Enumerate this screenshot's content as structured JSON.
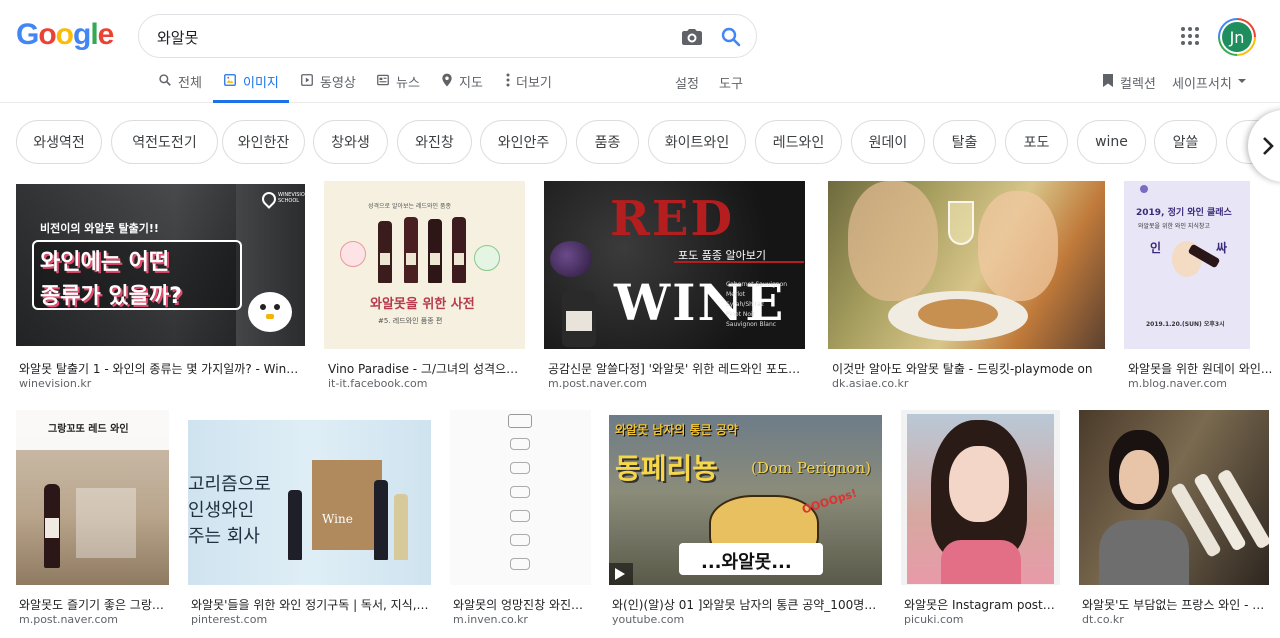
{
  "logo": "Google",
  "search": {
    "value": "와알못"
  },
  "header": {
    "avatar_initials": "Jn"
  },
  "tabs": [
    {
      "label": "전체"
    },
    {
      "label": "이미지"
    },
    {
      "label": "동영상"
    },
    {
      "label": "뉴스"
    },
    {
      "label": "지도"
    },
    {
      "label": "더보기"
    }
  ],
  "tools": {
    "settings": "설정",
    "tools": "도구",
    "collections": "컬렉션",
    "safesearch": "세이프서치"
  },
  "chips": [
    "와생역전",
    "역전도전기",
    "와인한잔",
    "창와생",
    "와진창",
    "와인안주",
    "품종",
    "화이트와인",
    "레드와인",
    "원데이",
    "탈출",
    "포도",
    "wine",
    "알쓸"
  ],
  "results": [
    {
      "title": "와알못 탈출기 1 - 와인의 종류는 몇 가지일까? - Winevisio...",
      "source": "winevision.kr",
      "overlay": [
        "비전이의 와알못 탈출기!!",
        "와인에는 어떤",
        "종류가 있을까?",
        "WINEVISION SCHOOL"
      ]
    },
    {
      "title": "Vino Paradise - 그/그녀의 성격으로 ...",
      "source": "it-it.facebook.com",
      "overlay": [
        "성격으로 알아보는 레드와인 품종",
        "와알못을 위한 사전",
        "#5. 레드와인 품종 편"
      ]
    },
    {
      "title": "공감신문 알쓸다정] '와알못' 위한 레드와인 포도 품종 ...",
      "source": "m.post.naver.com",
      "overlay": [
        "RED",
        "WINE",
        "포도 품종 알아보기",
        "Cabernet Sauvignon",
        "Merlot",
        "Syrah/Shiraz",
        "Pinot Noir",
        "Sauvignon Blanc"
      ]
    },
    {
      "title": "이것만 알아도 와알못 탈출 - 드링킷-playmode on",
      "source": "dk.asiae.co.kr",
      "overlay": []
    },
    {
      "title": "와알못을 위한 원데이 와인...",
      "source": "m.blog.naver.com",
      "overlay": [
        "2019, 정기 와인 클래스",
        "와알못을 위한 와인 지식창고",
        "인",
        "싸",
        "2019.1.20.(SUN) 오후3시"
      ]
    },
    {
      "title": "와알못도 즐기기 좋은 그랑꼬...",
      "source": "m.post.naver.com",
      "overlay": [
        "그랑꼬또 레드 와인"
      ]
    },
    {
      "title": "와알못'들을 위한 와인 정기구독 | 독서, 지식, 긍정...",
      "source": "pinterest.com",
      "overlay": [
        "고리즘으로",
        "인생와인",
        "주는 회사",
        "Wine"
      ]
    },
    {
      "title": "와알못의 엉망진창 와진창 ...",
      "source": "m.inven.co.kr",
      "overlay": []
    },
    {
      "title": "와(인)(알)상 01 ]와알못 남자의 통큰 공약_100명 구독...",
      "source": "youtube.com",
      "overlay": [
        "와알못 남자의 통큰 공약",
        "동페리뇽",
        "(Dom Perignon)",
        "OOOOps!",
        "...와알못..."
      ]
    },
    {
      "title": "와알못은 Instagram posts (...",
      "source": "picuki.com",
      "overlay": []
    },
    {
      "title": "와알못'도 부담없는 프랑스 와인 - [디...",
      "source": "dt.co.kr",
      "overlay": []
    }
  ]
}
